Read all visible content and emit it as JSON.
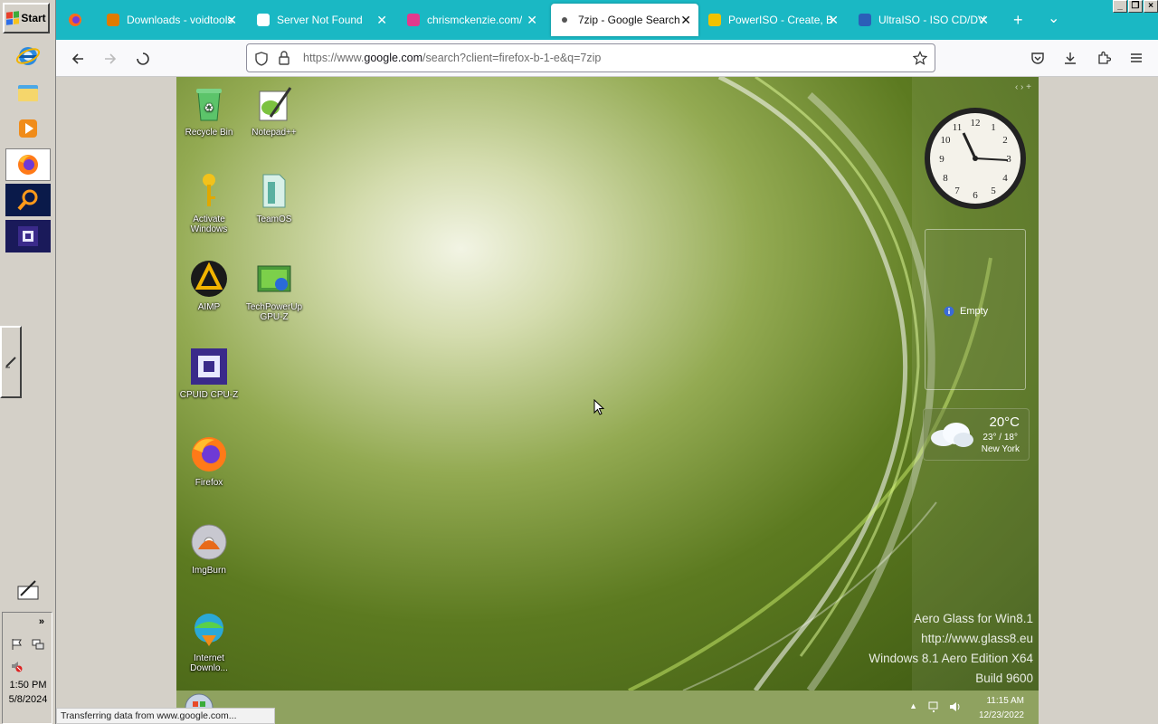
{
  "taskbar": {
    "start_label": "Start",
    "quick_launch": [
      {
        "name": "Internet Explorer",
        "icon": "ie-icon"
      },
      {
        "name": "Windows Explorer",
        "icon": "folder-icon"
      },
      {
        "name": "Media Player",
        "icon": "media-player-icon"
      },
      {
        "name": "Firefox",
        "icon": "firefox-icon"
      },
      {
        "name": "Search",
        "icon": "magnifier-icon"
      },
      {
        "name": "CPU-Z",
        "icon": "cpuz-icon"
      }
    ],
    "tray_time": "1:50 PM",
    "tray_date": "5/8/2024",
    "tray_chevron": "»"
  },
  "browser": {
    "tabs": [
      {
        "label": "Downloads - voidtools",
        "active": false,
        "favicon_color": "#e07b00"
      },
      {
        "label": "Server Not Found",
        "active": false,
        "favicon_color": "#ffffff"
      },
      {
        "label": "chrismckenzie.com/",
        "active": false,
        "favicon_color": "#e23a8d"
      },
      {
        "label": "7zip - Google Search",
        "active": true,
        "favicon_color": "#555555"
      },
      {
        "label": "PowerISO - Create, B",
        "active": false,
        "favicon_color": "#f2c200"
      },
      {
        "label": "UltraISO - ISO CD/DV",
        "active": false,
        "favicon_color": "#2b5fb8"
      }
    ],
    "new_tab": "+",
    "tab_list": "⌄",
    "tab_close": "✕",
    "url_prefix": "https://www.",
    "url_host": "google.com",
    "url_path": "/search?client=firefox-b-1-e&q=7zip",
    "status": "Transferring data from www.google.com..."
  },
  "remote_desktop": {
    "icons": [
      {
        "label": "Recycle Bin"
      },
      {
        "label": "Notepad++"
      },
      {
        "label": "Activate Windows"
      },
      {
        "label": "TeamOS"
      },
      {
        "label": "AIMP"
      },
      {
        "label": "TechPowerUp GPU-Z"
      },
      {
        "label": "CPUID CPU-Z"
      },
      {
        "label": "Firefox"
      },
      {
        "label": "ImgBurn"
      },
      {
        "label": "Internet Downlo..."
      }
    ],
    "slideshow_label": "Empty",
    "weather": {
      "temp": "20°C",
      "range": "23° / 18°",
      "city": "New York"
    },
    "watermark": [
      "Aero Glass for Win8.1",
      "http://www.glass8.eu",
      "Windows 8.1 Aero Edition X64",
      "Build 9600"
    ],
    "taskbar_time": "11:15 AM",
    "taskbar_date": "12/23/2022",
    "gadget_controls": "‹ › +"
  }
}
